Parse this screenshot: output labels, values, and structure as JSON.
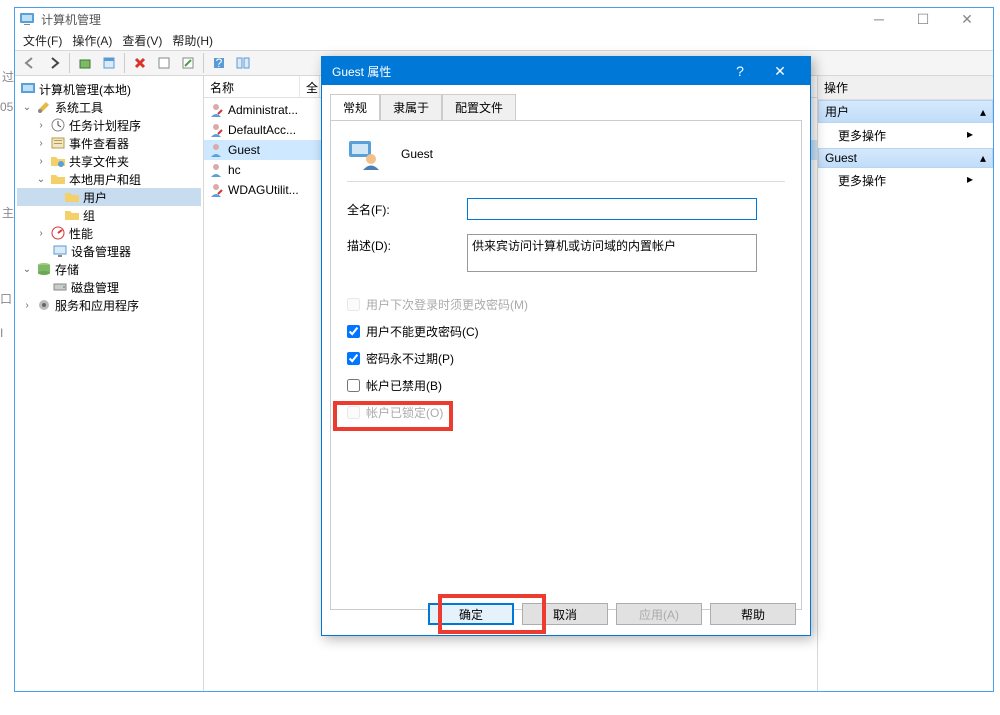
{
  "main_window": {
    "title": "计算机管理",
    "menus": [
      "文件(F)",
      "操作(A)",
      "查看(V)",
      "帮助(H)"
    ]
  },
  "tree": {
    "root": "计算机管理(本地)",
    "system_tools": "系统工具",
    "task_scheduler": "任务计划程序",
    "event_viewer": "事件查看器",
    "shared_folders": "共享文件夹",
    "local_users": "本地用户和组",
    "users": "用户",
    "groups": "组",
    "performance": "性能",
    "device_manager": "设备管理器",
    "storage": "存储",
    "disk_mgmt": "磁盘管理",
    "services": "服务和应用程序"
  },
  "list": {
    "col_name": "名称",
    "col_full": "全",
    "rows": [
      "Administrat...",
      "DefaultAcc...",
      "Guest",
      "hc",
      "WDAGUtilit..."
    ]
  },
  "actions": {
    "title": "操作",
    "group_user": "用户",
    "group_guest": "Guest",
    "more": "更多操作"
  },
  "dialog": {
    "title": "Guest 属性",
    "tabs": [
      "常规",
      "隶属于",
      "配置文件"
    ],
    "username": "Guest",
    "full_name_label": "全名(F):",
    "full_name_value": "",
    "desc_label": "描述(D):",
    "desc_value": "供来宾访问计算机或访问域的内置帐户",
    "chk_mustchange": "用户下次登录时须更改密码(M)",
    "chk_cannotchange": "用户不能更改密码(C)",
    "chk_neverexpire": "密码永不过期(P)",
    "chk_disabled": "帐户已禁用(B)",
    "chk_locked": "帐户已锁定(O)",
    "btn_ok": "确定",
    "btn_cancel": "取消",
    "btn_apply": "应用(A)",
    "btn_help": "帮助"
  }
}
